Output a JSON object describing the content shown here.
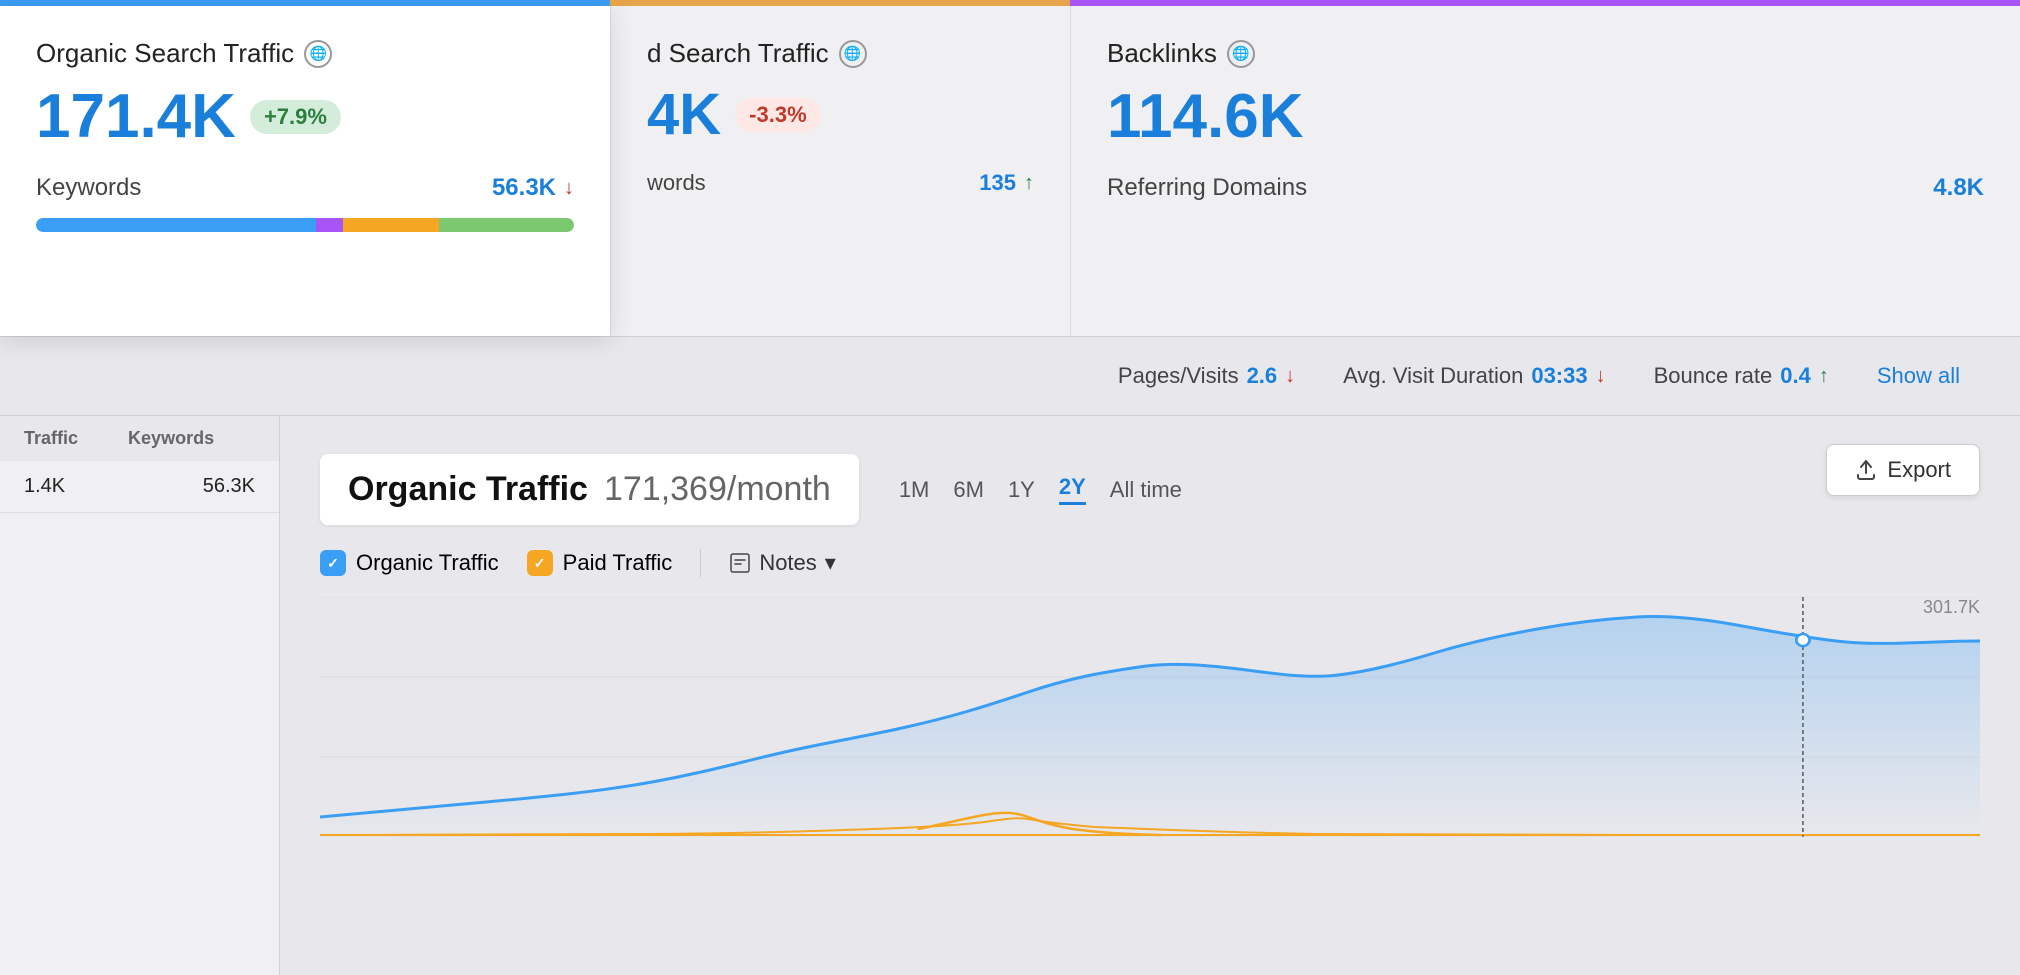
{
  "topBar": {
    "colors": [
      "#3b9ef5",
      "#e8a44a",
      "#a855f7"
    ]
  },
  "cards": [
    {
      "title": "Organic Search Traffic",
      "value": "171.4K",
      "badge": "+7.9%",
      "badgeType": "positive",
      "metric_label": "Keywords",
      "metric_value": "56.3K",
      "metric_arrow": "down"
    },
    {
      "title": "d Search Traffic",
      "value": "4K",
      "badge": "-3.3%",
      "badgeType": "negative",
      "metric_label": "words",
      "metric_value": "135",
      "metric_arrow": "up"
    },
    {
      "title": "Backlinks",
      "value": "114.6K",
      "metric_label": "Referring Domains",
      "metric_value": "4.8K",
      "metric_arrow": null
    }
  ],
  "statsBar": {
    "pages_visits_label": "Pages/Visits",
    "pages_visits_value": "2.6",
    "pages_visits_arrow": "down",
    "avg_duration_label": "Avg. Visit Duration",
    "avg_duration_value": "03:33",
    "avg_duration_arrow": "down",
    "bounce_rate_label": "Bounce rate",
    "bounce_rate_value": "0.4",
    "bounce_rate_arrow": "up",
    "show_all_label": "Show all"
  },
  "exportButton": {
    "label": "Export",
    "icon": "export-icon"
  },
  "chartSection": {
    "title": "Organic Traffic",
    "value": "171,369/month",
    "timeRanges": [
      "1M",
      "6M",
      "1Y",
      "2Y",
      "All time"
    ],
    "activeRange": "2Y"
  },
  "legend": {
    "organicTraffic": "Organic Traffic",
    "paidTraffic": "Paid Traffic",
    "notes": "Notes",
    "notesArrow": "▾"
  },
  "chartData": {
    "yAxisMax": "301.7K",
    "curve": "organic"
  },
  "sidebar": {
    "header1": "Traffic",
    "header2": "Keywords",
    "row1_traffic": "1.4K",
    "row1_keywords": "56.3K"
  }
}
